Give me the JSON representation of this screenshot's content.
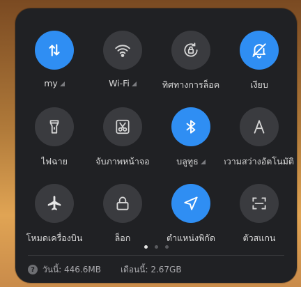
{
  "tiles": [
    {
      "label": "my",
      "icon": "data-transfer-icon",
      "active": true,
      "sub": true
    },
    {
      "label": "Wi-Fi",
      "icon": "wifi-icon",
      "active": false,
      "sub": true
    },
    {
      "label": "ทิศทางการล็อค",
      "icon": "rotation-lock-icon",
      "active": false,
      "sub": false
    },
    {
      "label": "เงียบ",
      "icon": "silent-bell-icon",
      "active": true,
      "sub": false
    },
    {
      "label": "ไฟฉาย",
      "icon": "flashlight-icon",
      "active": false,
      "sub": false
    },
    {
      "label": "จับภาพหน้าจอ",
      "icon": "screenshot-icon",
      "active": false,
      "sub": false
    },
    {
      "label": "บลูทูธ",
      "icon": "bluetooth-icon",
      "active": true,
      "sub": true
    },
    {
      "label": "ความสว่างอัตโนมัติ",
      "icon": "auto-brightness-icon",
      "active": false,
      "sub": false
    },
    {
      "label": "โหมดเครื่องบิน",
      "icon": "airplane-icon",
      "active": false,
      "sub": false
    },
    {
      "label": "ล็อก",
      "icon": "lock-icon",
      "active": false,
      "sub": false
    },
    {
      "label": "ตำแหน่งพิกัด",
      "icon": "location-icon",
      "active": true,
      "sub": false
    },
    {
      "label": "ตัวสแกน",
      "icon": "scanner-icon",
      "active": false,
      "sub": false
    }
  ],
  "pager": {
    "count": 3,
    "active": 0
  },
  "footer": {
    "help_icon": "help-icon",
    "today": "วันนี้: 446.6MB",
    "month": "เดือนนี้: 2.67GB"
  },
  "colors": {
    "active": "#2f8ef3",
    "inactive": "#3a3b3f",
    "panel": "#202124"
  }
}
